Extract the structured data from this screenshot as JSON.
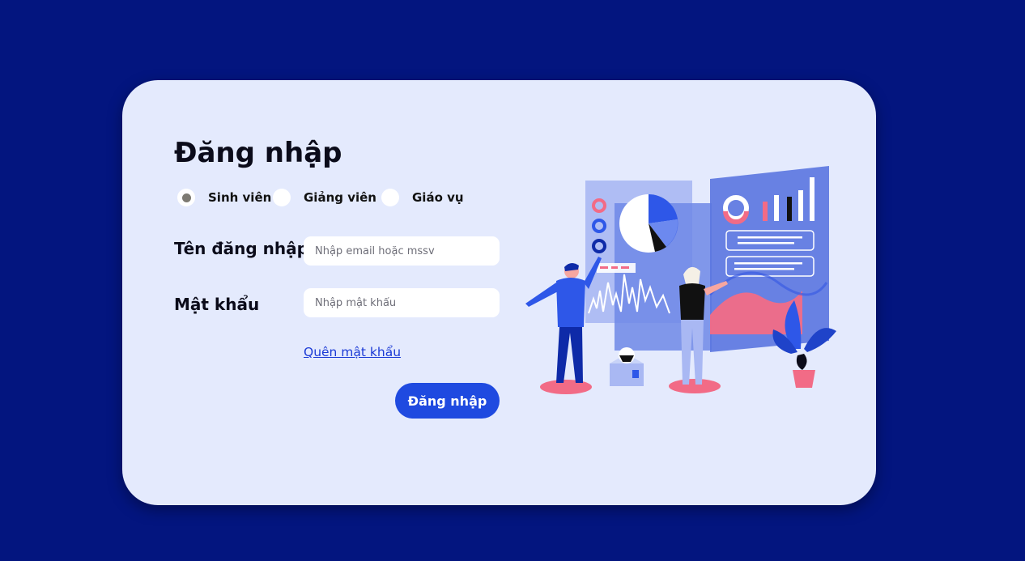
{
  "login": {
    "title": "Đăng nhập",
    "roles": [
      {
        "label": "Sinh viên",
        "selected": true
      },
      {
        "label": "Giảng viên",
        "selected": false
      },
      {
        "label": "Giáo vụ",
        "selected": false
      }
    ],
    "username_label": "Tên đăng nhập",
    "username_placeholder": "Nhập email hoặc mssv",
    "password_label": "Mật khẩu",
    "password_placeholder": "Nhập mật khẩu",
    "forgot_link": "Quên mật khẩu",
    "submit_label": "Đăng nhập"
  },
  "colors": {
    "background": "#03157f",
    "card": "#e4eafd",
    "accent": "#1f4ae0",
    "link": "#1c3bd6",
    "illustration_pink": "#f26b86",
    "illustration_blue": "#2e57e8"
  },
  "illustration": {
    "icon": "data-analytics-illustration-icon"
  }
}
